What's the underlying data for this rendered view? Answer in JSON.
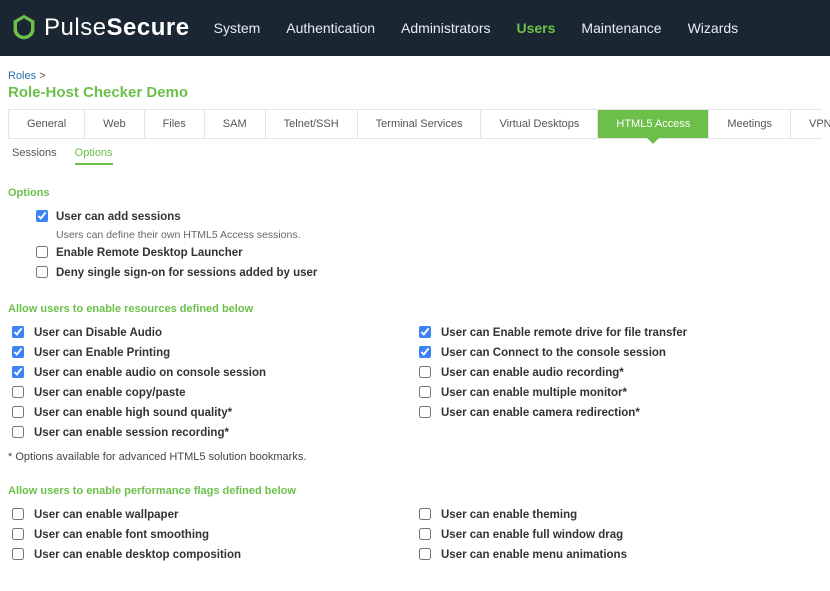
{
  "brand": {
    "part1": "Pulse",
    "part2": "Secure"
  },
  "nav": {
    "items": [
      {
        "label": "System"
      },
      {
        "label": "Authentication"
      },
      {
        "label": "Administrators"
      },
      {
        "label": "Users",
        "active": true
      },
      {
        "label": "Maintenance"
      },
      {
        "label": "Wizards"
      }
    ]
  },
  "breadcrumb": {
    "link": "Roles",
    "sep": ">"
  },
  "page_title": "Role-Host Checker Demo",
  "primary_tabs": [
    {
      "label": "General"
    },
    {
      "label": "Web"
    },
    {
      "label": "Files"
    },
    {
      "label": "SAM"
    },
    {
      "label": "Telnet/SSH"
    },
    {
      "label": "Terminal Services"
    },
    {
      "label": "Virtual Desktops"
    },
    {
      "label": "HTML5 Access",
      "active": true
    },
    {
      "label": "Meetings"
    },
    {
      "label": "VPN Tunneling"
    }
  ],
  "secondary_tabs": [
    {
      "label": "Sessions"
    },
    {
      "label": "Options",
      "active": true
    }
  ],
  "sections": {
    "options": {
      "title": "Options",
      "items": [
        {
          "label": "User can add sessions",
          "checked": true,
          "desc": "Users can define their own HTML5 Access sessions."
        },
        {
          "label": "Enable Remote Desktop Launcher",
          "checked": false
        },
        {
          "label": "Deny single sign-on for sessions added by user",
          "checked": false
        }
      ]
    },
    "resources": {
      "title": "Allow users to enable resources defined below",
      "left": [
        {
          "label": "User can Disable Audio",
          "checked": true
        },
        {
          "label": "User can Enable Printing",
          "checked": true
        },
        {
          "label": "User can enable audio on console session",
          "checked": true
        },
        {
          "label": "User can enable copy/paste",
          "checked": false
        },
        {
          "label": "User can enable high sound quality*",
          "checked": false
        },
        {
          "label": "User can enable session recording*",
          "checked": false
        }
      ],
      "right": [
        {
          "label": "User can Enable remote drive for file transfer",
          "checked": true
        },
        {
          "label": "User can Connect to the console session",
          "checked": true
        },
        {
          "label": "User can enable audio recording*",
          "checked": false
        },
        {
          "label": "User can enable multiple monitor*",
          "checked": false
        },
        {
          "label": "User can enable camera redirection*",
          "checked": false
        }
      ],
      "footnote": "* Options available for advanced HTML5 solution bookmarks."
    },
    "performance": {
      "title": "Allow users to enable performance flags defined below",
      "left": [
        {
          "label": "User can enable wallpaper",
          "checked": false
        },
        {
          "label": "User can enable font smoothing",
          "checked": false
        },
        {
          "label": "User can enable desktop composition",
          "checked": false
        }
      ],
      "right": [
        {
          "label": "User can enable theming",
          "checked": false
        },
        {
          "label": "User can enable full window drag",
          "checked": false
        },
        {
          "label": "User can enable menu animations",
          "checked": false
        }
      ]
    }
  }
}
